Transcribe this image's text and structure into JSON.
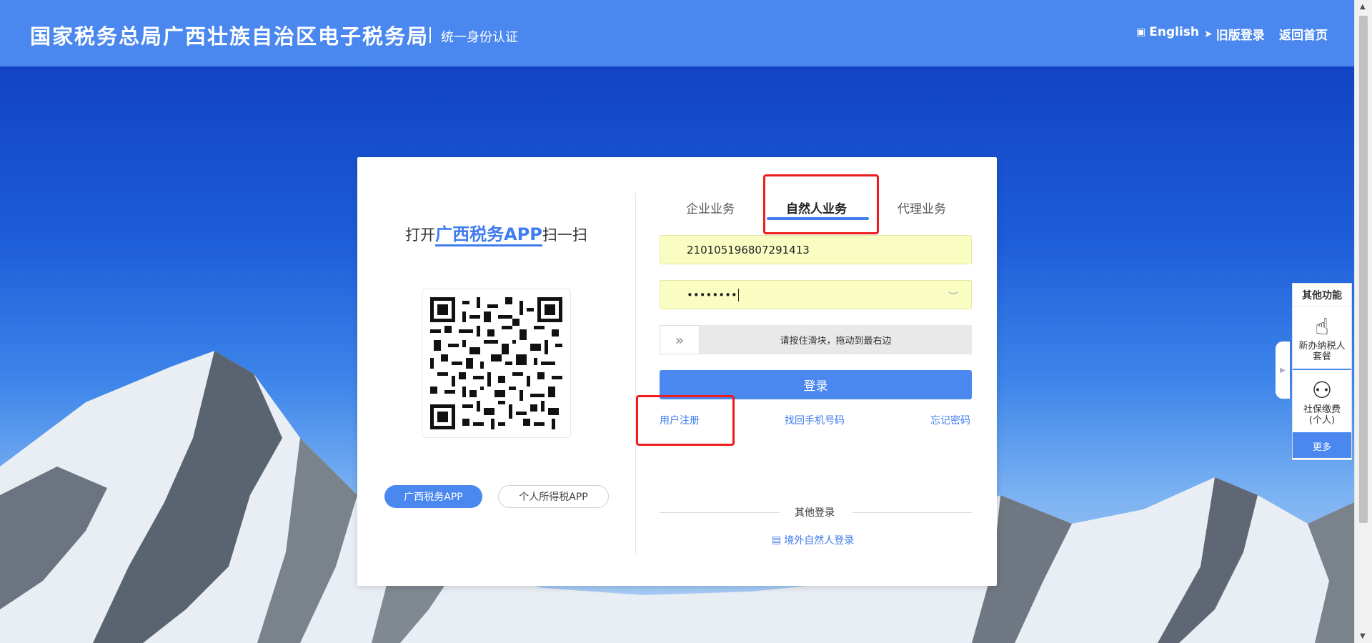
{
  "header": {
    "title": "国家税务总局广西壮族自治区电子税务局",
    "subtitle": "统一身份认证",
    "nav": [
      {
        "label": "English",
        "icon": "english-icon"
      },
      {
        "label": "旧版登录",
        "icon": "send-icon"
      },
      {
        "label": "返回首页",
        "icon": ""
      }
    ]
  },
  "qr": {
    "title_prefix": "打开",
    "title_app": "广西税务APP",
    "title_suffix": "扫一扫",
    "app_buttons": [
      "广西税务APP",
      "个人所得税APP"
    ]
  },
  "tabs": [
    "企业业务",
    "自然人业务",
    "代理业务"
  ],
  "active_tab": "自然人业务",
  "form": {
    "id_value": "210105196807291413",
    "password_masked": "••••••••",
    "slider_text": "请按住滑块，拖动到最右边",
    "login_label": "登录"
  },
  "links": [
    "用户注册",
    "找回手机号码",
    "忘记密码"
  ],
  "other_login": {
    "label": "其他登录",
    "overseas": "境外自然人登录"
  },
  "side_widget": {
    "title": "其他功能",
    "items": [
      {
        "line1": "新办纳税人",
        "line2": "套餐",
        "icon": "hand-pointer-icon"
      },
      {
        "line1": "社保缴费",
        "line2": "(个人)",
        "icon": "person-icon"
      }
    ],
    "more": "更多"
  },
  "colors": {
    "header_bg": "#4a88ef",
    "accent": "#3f7cf0",
    "field_bg": "#fafdc2",
    "highlight_box": "#ee1c1c"
  }
}
